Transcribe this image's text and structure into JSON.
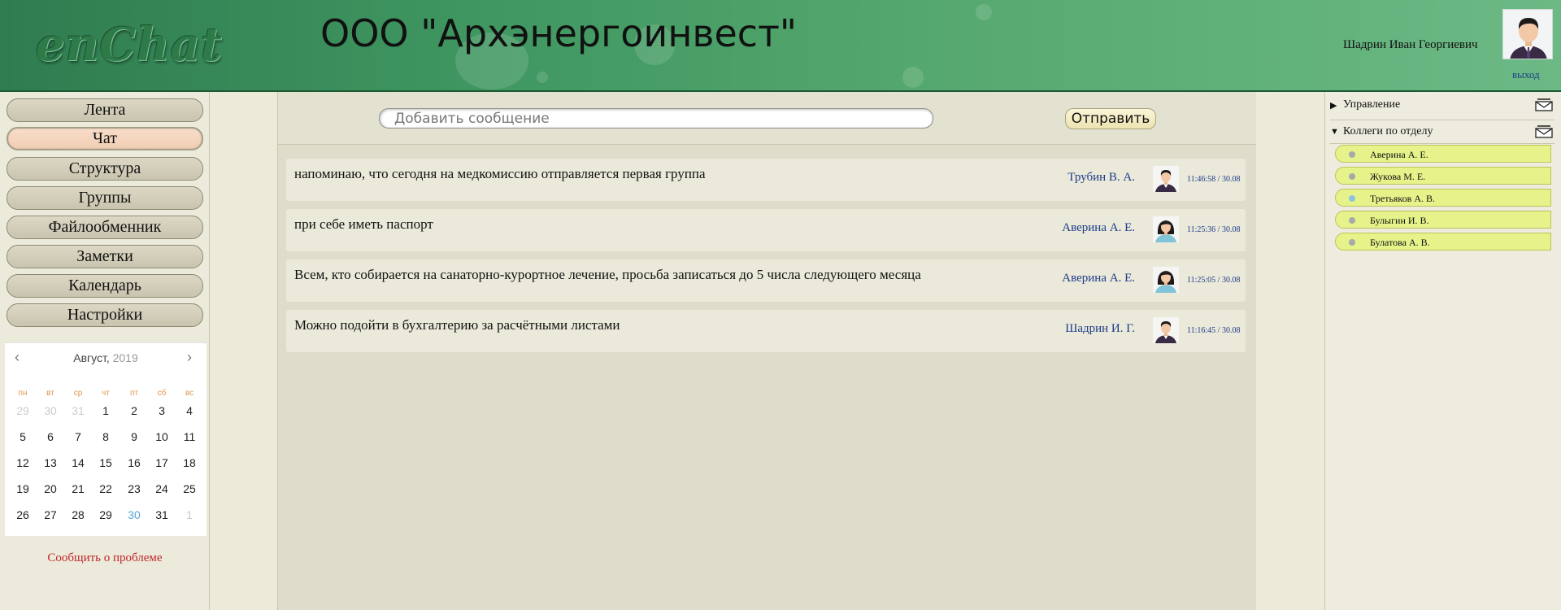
{
  "app": {
    "logo": "enChat",
    "org_title": "ООО \"Архэнергоинвест\""
  },
  "user": {
    "name": "Шадрин Иван Георгиевич",
    "logout_label": "выход"
  },
  "nav": [
    {
      "label": "Лента",
      "active": false
    },
    {
      "label": "Чат",
      "active": true
    },
    {
      "label": "Структура",
      "active": false
    },
    {
      "label": "Группы",
      "active": false
    },
    {
      "label": "Файлообменник",
      "active": false
    },
    {
      "label": "Заметки",
      "active": false
    },
    {
      "label": "Календарь",
      "active": false
    },
    {
      "label": "Настройки",
      "active": false
    }
  ],
  "calendar": {
    "month": "Август,",
    "year": "2019",
    "weekdays": [
      "пн",
      "вт",
      "ср",
      "чт",
      "пт",
      "сб",
      "вс"
    ],
    "weeks": [
      [
        "29",
        "30",
        "31",
        "1",
        "2",
        "3",
        "4"
      ],
      [
        "5",
        "6",
        "7",
        "8",
        "9",
        "10",
        "11"
      ],
      [
        "12",
        "13",
        "14",
        "15",
        "16",
        "17",
        "18"
      ],
      [
        "19",
        "20",
        "21",
        "22",
        "23",
        "24",
        "25"
      ],
      [
        "26",
        "27",
        "28",
        "29",
        "30",
        "31",
        "1"
      ]
    ],
    "today": "30"
  },
  "report_problem": "Сообщить о проблеме",
  "composer": {
    "placeholder": "Добавить сообщение",
    "send_label": "Отправить"
  },
  "messages": [
    {
      "text": "напоминаю, что сегодня на медкомиссию отправляется первая группа",
      "author": "Трубин В. А.",
      "time": "11:46:58 / 30.08",
      "avatar": "male"
    },
    {
      "text": "при себе иметь паспорт",
      "author": "Аверина А. Е.",
      "time": "11:25:36 / 30.08",
      "avatar": "female"
    },
    {
      "text": "Всем, кто собирается на санаторно-курортное лечение, просьба записаться до 5 числа следующего месяца",
      "author": "Аверина А. Е.",
      "time": "11:25:05 / 30.08",
      "avatar": "female"
    },
    {
      "text": "Можно подойти в бухгалтерию за расчётными листами",
      "author": "Шадрин И. Г.",
      "time": "11:16:45 / 30.08",
      "avatar": "male"
    }
  ],
  "sidebar": {
    "management": {
      "label": "Управление",
      "expanded": false
    },
    "colleagues": {
      "label": "Коллеги по отделу",
      "expanded": true,
      "items": [
        {
          "name": "Аверина А. Е.",
          "online": false
        },
        {
          "name": "Жукова М. Е.",
          "online": false
        },
        {
          "name": "Третьяков А. В.",
          "online": true
        },
        {
          "name": "Булыгин И. В.",
          "online": false
        },
        {
          "name": "Булатова А. В.",
          "online": false
        }
      ]
    }
  },
  "colors": {
    "header_green": "#3f9660",
    "active_tab": "#f3d2ba",
    "colleague_bg": "#e6f28a",
    "author_blue": "#1d3b8c",
    "report_red": "#c0262b"
  }
}
